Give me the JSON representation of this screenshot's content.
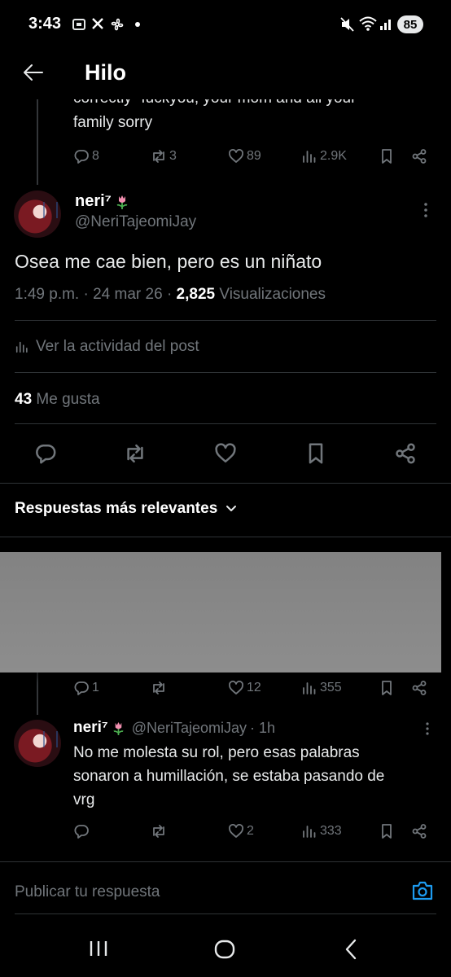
{
  "status_bar": {
    "time": "3:43",
    "battery": "85"
  },
  "header": {
    "title": "Hilo"
  },
  "prev_tweet": {
    "text_line1": "correctly -fuckyou, your mom and all your",
    "text_line2": "family sorry",
    "stats": {
      "replies": "8",
      "reposts": "3",
      "likes": "89",
      "views": "2.9K"
    }
  },
  "main_tweet": {
    "name": "neri⁷",
    "handle": "@NeriTajeomiJay",
    "text": "Osea me cae bien, pero es un niñato",
    "time": "1:49 p.m.",
    "dot1": "·",
    "date": "24 mar 26",
    "dot2": "·",
    "views_count": "2,825",
    "views_label": "Visualizaciones",
    "activity": "Ver la actividad del post",
    "likes_count": "43",
    "likes_label": "Me gusta"
  },
  "replies_sort": {
    "label": "Respuestas más relevantes"
  },
  "hidden_reply": {
    "stats": {
      "replies": "1",
      "reposts": "",
      "likes": "12",
      "views": "355"
    }
  },
  "reply": {
    "name": "neri⁷",
    "handle": "@NeriTajeomiJay",
    "time": "· 1h",
    "line1": "No me molesta su rol, pero esas palabras",
    "line2": "sonaron a humillación, se estaba pasando de",
    "line3": "vrg",
    "stats": {
      "replies": "",
      "reposts": "",
      "likes": "2",
      "views": "333"
    }
  },
  "composer": {
    "placeholder": "Publicar tu respuesta"
  },
  "colors": {
    "accent": "#1d9bf0",
    "background": "#000000",
    "text": "#e7e9ea",
    "muted": "#71767b"
  }
}
